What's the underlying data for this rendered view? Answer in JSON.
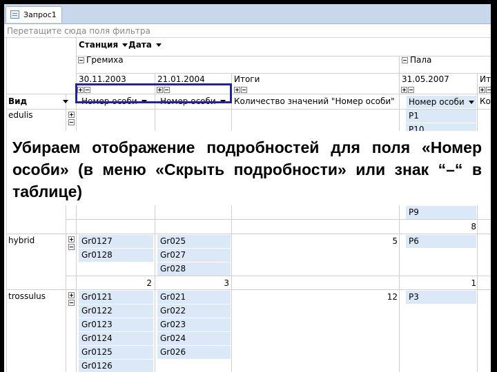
{
  "tab": {
    "label": "Запрос1"
  },
  "filter_zone": {
    "placeholder": "Перетащите сюда поля фильтра"
  },
  "column_fields": [
    {
      "label": "Станция"
    },
    {
      "label": "Дата"
    }
  ],
  "stations": [
    {
      "name": "Гремиха"
    },
    {
      "name": "Пала"
    }
  ],
  "dates": [
    {
      "label": "30.11.2003"
    },
    {
      "label": "21.01.2004"
    },
    {
      "label": "Итоги"
    },
    {
      "label": "31.05.2007"
    },
    {
      "label": "Ито"
    }
  ],
  "row_field": {
    "label": "Вид"
  },
  "data_headers": [
    {
      "label": "Номер особи"
    },
    {
      "label": "Номер особи"
    },
    {
      "label": "Количество значений \"Номер особи\""
    },
    {
      "label": "Номер особи"
    },
    {
      "label": "Ко"
    }
  ],
  "rows": [
    {
      "species": "edulis",
      "col1": [],
      "col2": [],
      "col4": [
        "P1",
        "P10",
        "P9"
      ],
      "total_col4": "8"
    },
    {
      "species": "hybrid",
      "col1": [
        "Gr0127",
        "Gr0128"
      ],
      "col2": [
        "Gr025",
        "Gr027",
        "Gr028"
      ],
      "count": "5",
      "col4": [
        "P6"
      ],
      "total_col1": "2",
      "total_col2": "3",
      "total_col4": "1"
    },
    {
      "species": "trossulus",
      "col1": [
        "Gr0121",
        "Gr0122",
        "Gr0123",
        "Gr0124",
        "Gr0125",
        "Gr0126"
      ],
      "col2": [
        "Gr021",
        "Gr022",
        "Gr023",
        "Gr024",
        "Gr026"
      ],
      "count": "12",
      "col4": [
        "P3"
      ]
    }
  ],
  "callout": {
    "text": "Убираем отображение подробностей для поля «Номер особи» (в меню «Скрыть подробности» или знак “–“ в таблице)"
  }
}
